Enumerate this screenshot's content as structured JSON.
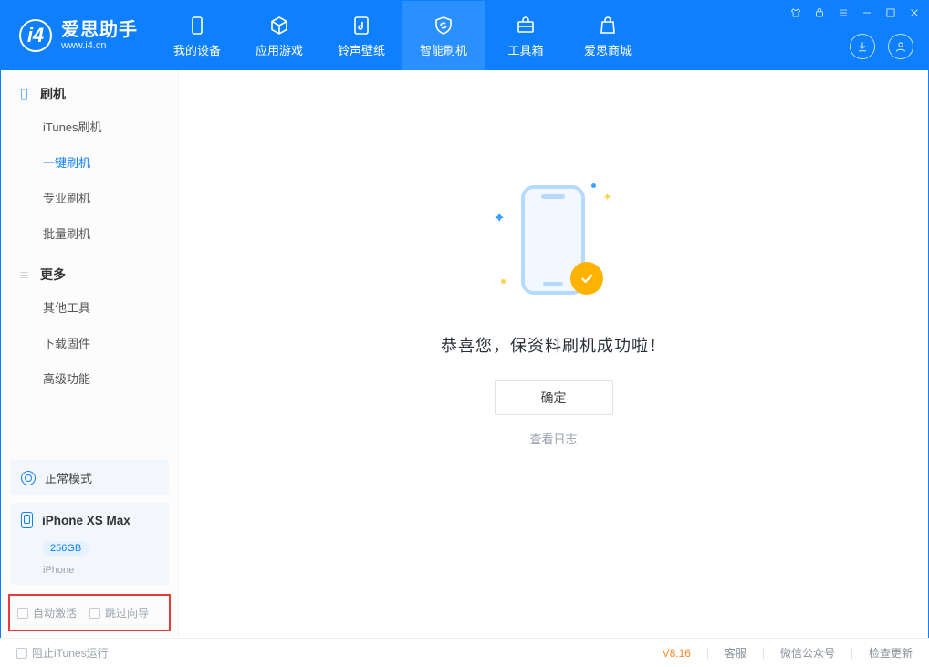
{
  "logo": {
    "cn": "爱思助手",
    "en": "www.i4.cn"
  },
  "tabs": {
    "device": "我的设备",
    "apps": "应用游戏",
    "ring": "铃声壁纸",
    "flash": "智能刷机",
    "toolbox": "工具箱",
    "store": "爱思商城"
  },
  "sidebar": {
    "group1": "刷机",
    "items1": {
      "itunes": "iTunes刷机",
      "onekey": "一键刷机",
      "pro": "专业刷机",
      "batch": "批量刷机"
    },
    "group2": "更多",
    "items2": {
      "other": "其他工具",
      "firmware": "下载固件",
      "advanced": "高级功能"
    },
    "mode": "正常模式",
    "device_name": "iPhone XS Max",
    "device_cap": "256GB",
    "device_type": "iPhone",
    "chk_auto": "自动激活",
    "chk_skip": "跳过向导"
  },
  "main": {
    "success": "恭喜您，保资料刷机成功啦！",
    "ok": "确定",
    "log": "查看日志"
  },
  "status": {
    "block_itunes": "阻止iTunes运行",
    "version": "V8.16",
    "support": "客服",
    "wechat": "微信公众号",
    "update": "检查更新"
  }
}
